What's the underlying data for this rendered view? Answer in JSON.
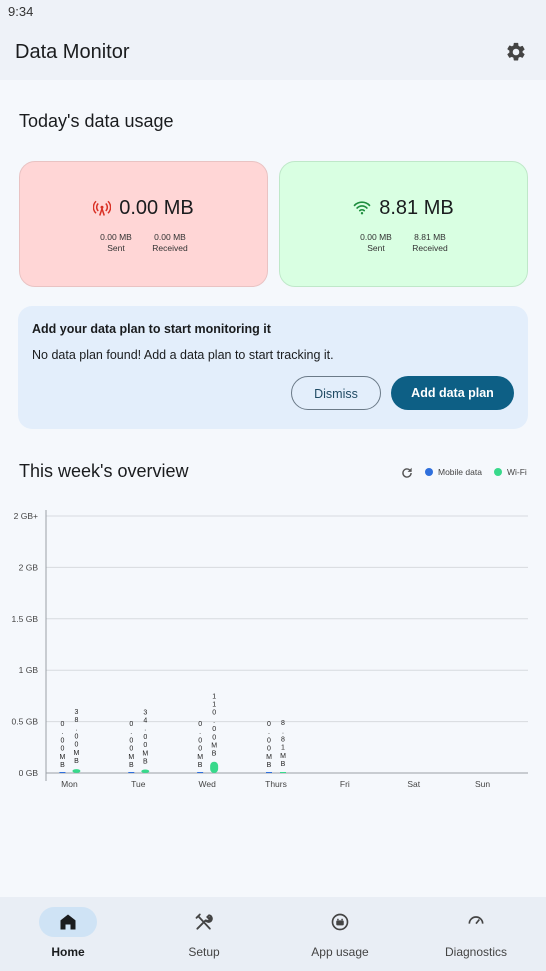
{
  "status_bar": {
    "time": "9:34"
  },
  "app": {
    "title": "Data Monitor"
  },
  "today": {
    "title": "Today's data usage",
    "mobile": {
      "total": "0.00 MB",
      "sent_value": "0.00 MB",
      "sent_label": "Sent",
      "received_value": "0.00 MB",
      "received_label": "Received",
      "color": "#d93025"
    },
    "wifi": {
      "total": "8.81 MB",
      "sent_value": "0.00 MB",
      "sent_label": "Sent",
      "received_value": "8.81 MB",
      "received_label": "Received",
      "color": "#1e8e3e"
    }
  },
  "plan_banner": {
    "title": "Add your data plan to start monitoring it",
    "message": "No data plan found! Add a data plan to start tracking it.",
    "dismiss_label": "Dismiss",
    "add_label": "Add data plan"
  },
  "week": {
    "title": "This week's overview",
    "legend": [
      {
        "name": "Mobile data",
        "color": "#2f6fdc"
      },
      {
        "name": "Wi-Fi",
        "color": "#38d98b"
      }
    ]
  },
  "chart_data": {
    "type": "bar",
    "categories": [
      "Mon",
      "Tue",
      "Wed",
      "Thurs",
      "Fri",
      "Sat",
      "Sun"
    ],
    "y_tick_labels": [
      "0 GB",
      "0.5 GB",
      "1 GB",
      "1.5 GB",
      "2 GB",
      "2 GB+"
    ],
    "ylim": [
      0,
      2.5
    ],
    "ylabel_unit": "GB",
    "series": [
      {
        "name": "Mobile data",
        "values": [
          0,
          0,
          0,
          0,
          null,
          null,
          null
        ],
        "labels": [
          "0.00MB",
          "0.00MB",
          "0.00MB",
          "0.00MB",
          "",
          "",
          ""
        ]
      },
      {
        "name": "Wi-Fi",
        "values": [
          0.038,
          0.034,
          0.11,
          0.0088,
          null,
          null,
          null
        ],
        "labels": [
          "38.00MB",
          "34.00MB",
          "110.00MB",
          "8.81MB",
          "",
          "",
          ""
        ]
      }
    ],
    "grid": true
  },
  "nav": [
    {
      "label": "Home",
      "icon": "home-icon",
      "active": true
    },
    {
      "label": "Setup",
      "icon": "tools-icon",
      "active": false
    },
    {
      "label": "App usage",
      "icon": "app-usage-icon",
      "active": false
    },
    {
      "label": "Diagnostics",
      "icon": "diagnostics-icon",
      "active": false
    }
  ]
}
